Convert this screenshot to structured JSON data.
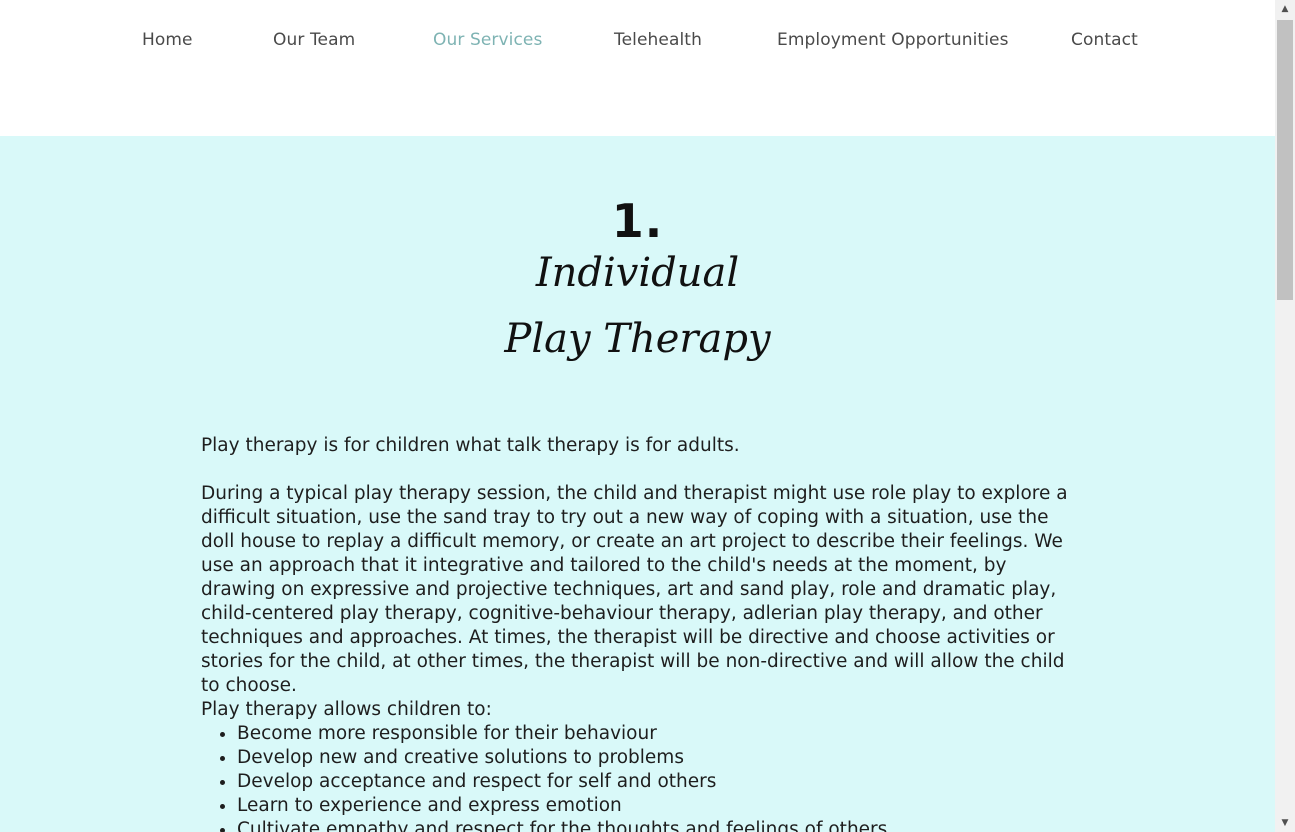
{
  "nav": {
    "items": [
      {
        "label": "Home"
      },
      {
        "label": "Our Team"
      },
      {
        "label": "Our Services"
      },
      {
        "label": "Telehealth"
      },
      {
        "label": "Employment Opportunities"
      },
      {
        "label": "Contact"
      }
    ],
    "active": "Our Services",
    "active_color": "#7eb3b3"
  },
  "section": {
    "background": "#d9f9f9",
    "number": "1.",
    "title_line1": "Individual",
    "title_line2": "Play Therapy",
    "paragraph1": "Play therapy is for children what talk therapy is for adults.",
    "paragraph2": "During a typical play therapy session, the child and therapist might use role play to explore a difficult situation, use the sand tray to try out a new way of coping with a situation, use the doll house to replay a difficult memory, or create an art project to describe their feelings. We use an approach that it integrative and tailored to the child's needs at the moment, by drawing on expressive and projective techniques, art and sand play, role and dramatic play, child-centered play therapy, cognitive-behaviour therapy, adlerian play therapy, and other techniques and approaches. At times, the therapist will be directive and choose activities or stories for the child, at other times, the therapist will be non-directive and will allow the child to choose.",
    "paragraph3": "Play therapy allows children to:",
    "benefits": [
      "Become more responsible for their behaviour",
      "Develop new and creative solutions to problems",
      "Develop acceptance and respect for self and others",
      "Learn to experience and express emotion",
      "Cultivate empathy and respect for the thoughts and feelings of others"
    ]
  },
  "scrollbar": {
    "up_icon": "triangle-up-icon",
    "down_icon": "triangle-down-icon"
  }
}
